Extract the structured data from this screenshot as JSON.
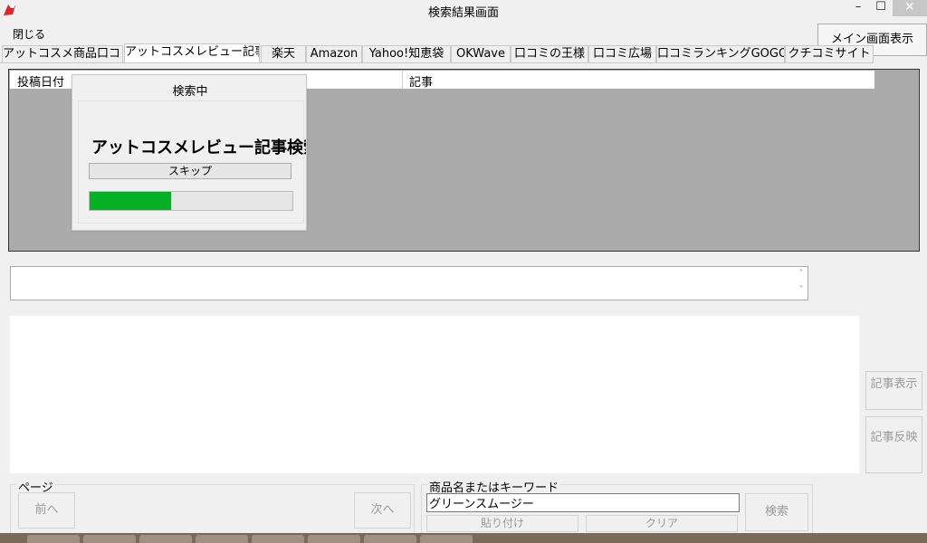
{
  "window": {
    "title": "検索結果画面",
    "min_label": "–",
    "max_label": "☐",
    "close_label": "×"
  },
  "menu": {
    "close": "閉じる"
  },
  "main_display_button": "メイン画面表示",
  "tabs": [
    {
      "label": "アットコスメ商品口コミ",
      "active": false
    },
    {
      "label": "アットコスメレビュー記事",
      "active": true
    },
    {
      "label": "楽天",
      "active": false
    },
    {
      "label": "Amazon",
      "active": false
    },
    {
      "label": "Yahoo!知恵袋",
      "active": false
    },
    {
      "label": "OKWave",
      "active": false
    },
    {
      "label": "口コミの王様",
      "active": false
    },
    {
      "label": "口コミ広場",
      "active": false
    },
    {
      "label": "口コミランキングGOGO",
      "active": false
    },
    {
      "label": "クチコミサイト",
      "active": false
    }
  ],
  "grid": {
    "columns": [
      "投稿日付",
      "記事"
    ]
  },
  "search_dialog": {
    "title": "検索中",
    "message": "アットコスメレビュー記事検索",
    "skip_label": "スキップ",
    "progress_percent": 40
  },
  "side_buttons": {
    "show_article": "記事表示",
    "reflect_article": "記事反映"
  },
  "page_group": {
    "legend": "ページ",
    "prev": "前へ",
    "next": "次へ"
  },
  "keyword_group": {
    "legend": "商品名またはキーワード",
    "value": "グリーンスムージー",
    "paste": "貼り付け",
    "clear": "クリア",
    "search": "検索"
  },
  "colors": {
    "progress": "#06b025",
    "grid_bg": "#ababab",
    "window_bg": "#f0f0f0"
  }
}
